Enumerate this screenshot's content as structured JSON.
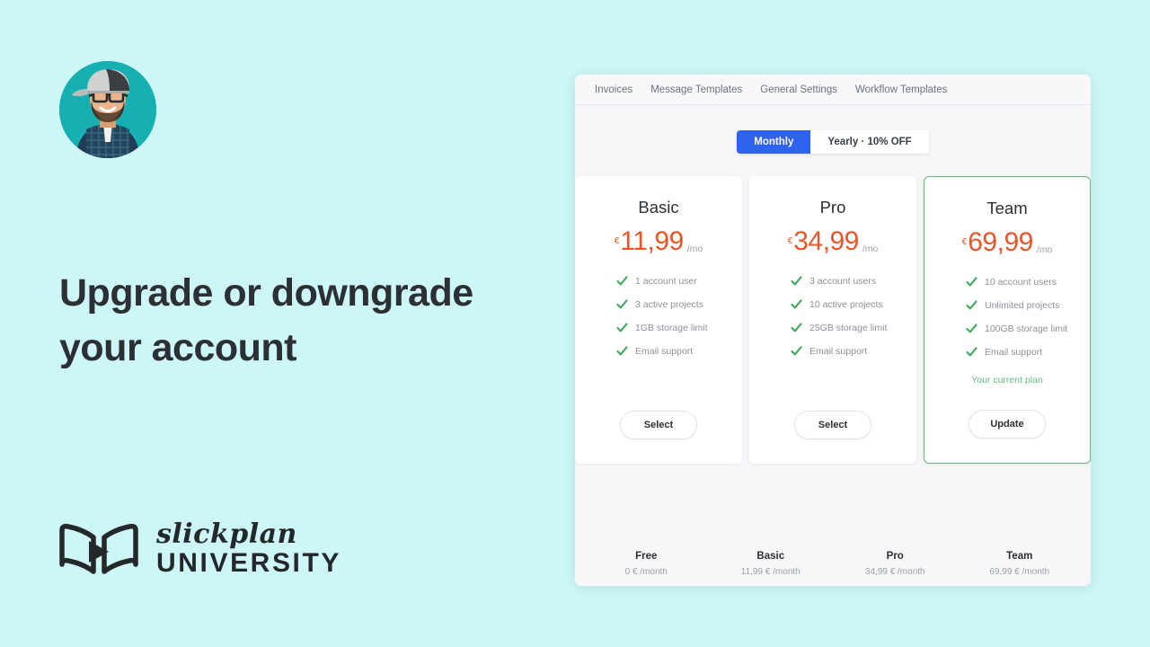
{
  "slide": {
    "headline": "Upgrade or downgrade your account",
    "logo": {
      "script_word": "slickplan",
      "block_word": "UNIVERSITY",
      "mark_icon": "open-book-play-icon"
    },
    "avatar_icon": "presenter-avatar"
  },
  "app": {
    "tabs": [
      {
        "label": "Invoices"
      },
      {
        "label": "Message Templates"
      },
      {
        "label": "General Settings"
      },
      {
        "label": "Workflow Templates"
      }
    ],
    "billing_toggle": {
      "options": [
        {
          "label": "Monthly",
          "active": true
        },
        {
          "label": "Yearly · 10% OFF",
          "active": false
        }
      ]
    },
    "plans": [
      {
        "name": "Basic",
        "currency": "€",
        "amount": "11,99",
        "period": "/mo",
        "features": [
          "1 account user",
          "3 active projects",
          "1GB storage limit",
          "Email support"
        ],
        "note": "",
        "cta": "Select",
        "current": false
      },
      {
        "name": "Pro",
        "currency": "€",
        "amount": "34,99",
        "period": "/mo",
        "features": [
          "3 account users",
          "10 active projects",
          "25GB storage limit",
          "Email support"
        ],
        "note": "",
        "cta": "Select",
        "current": false
      },
      {
        "name": "Team",
        "currency": "€",
        "amount": "69,99",
        "period": "/mo",
        "features": [
          "10 account users",
          "Unlimited projects",
          "100GB storage limit",
          "Email support"
        ],
        "note": "Your current plan",
        "cta": "Update",
        "current": true
      }
    ],
    "compare_row": [
      {
        "name": "Free",
        "price": "0 € /month"
      },
      {
        "name": "Basic",
        "price": "11,99 € /month"
      },
      {
        "name": "Pro",
        "price": "34,99 € /month"
      },
      {
        "name": "Team",
        "price": "69,99 € /month"
      }
    ]
  },
  "colors": {
    "background": "#cdf6f7",
    "accent_blue": "#2e62ef",
    "price_orange": "#e8552a",
    "check_green": "#3fa85c",
    "current_green": "#67bb7f",
    "text_dark": "#2c3034",
    "text_muted": "#8b9198",
    "panel": "#f7f7fa"
  }
}
